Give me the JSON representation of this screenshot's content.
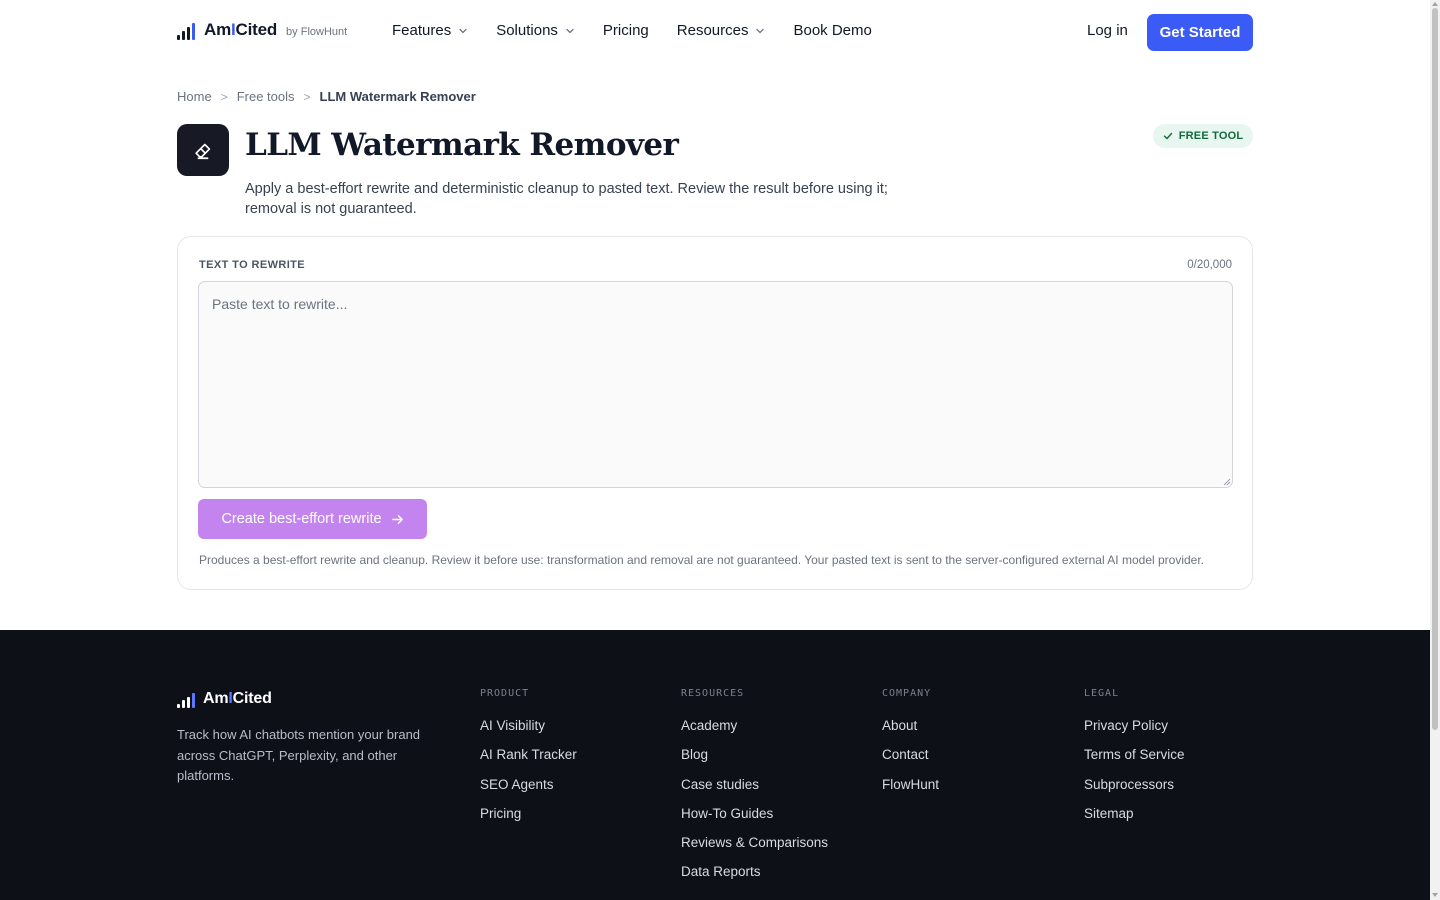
{
  "header": {
    "logo": {
      "name_prefix": "Am",
      "name_i": "I",
      "name_suffix": "Cited",
      "by": "by FlowHunt"
    },
    "nav": [
      {
        "label": "Features",
        "has_dropdown": true
      },
      {
        "label": "Solutions",
        "has_dropdown": true
      },
      {
        "label": "Pricing",
        "has_dropdown": false
      },
      {
        "label": "Resources",
        "has_dropdown": true
      },
      {
        "label": "Book Demo",
        "has_dropdown": false
      }
    ],
    "login_label": "Log in",
    "cta_label": "Get Started"
  },
  "breadcrumb": {
    "items": [
      "Home",
      "Free tools"
    ],
    "current": "LLM Watermark Remover",
    "separator": ">"
  },
  "tool": {
    "icon": "eraser-icon",
    "title": "LLM Watermark Remover",
    "subtitle_line1": "Apply a best-effort rewrite and deterministic cleanup to pasted text. Review the result before using it;",
    "subtitle_line2": "removal is not guaranteed.",
    "badge": "FREE TOOL"
  },
  "form": {
    "label": "TEXT TO REWRITE",
    "counter": "0/20,000",
    "value": "",
    "placeholder": "Paste text to rewrite...",
    "submit_label": "Create best-effort rewrite",
    "disclaimer": "Produces a best-effort rewrite and cleanup. Review it before use: transformation and removal are not guaranteed. Your pasted text is sent to the server-configured external AI model provider."
  },
  "footer": {
    "logo": {
      "name_prefix": "Am",
      "name_i": "I",
      "name_suffix": "Cited"
    },
    "tagline": "Track how AI chatbots mention your brand across ChatGPT, Perplexity, and other platforms.",
    "columns": [
      {
        "heading": "PRODUCT",
        "links": [
          "AI Visibility",
          "AI Rank Tracker",
          "SEO Agents",
          "Pricing"
        ]
      },
      {
        "heading": "RESOURCES",
        "links": [
          "Academy",
          "Blog",
          "Case studies",
          "How-To Guides",
          "Reviews & Comparisons",
          "Data Reports"
        ]
      },
      {
        "heading": "COMPANY",
        "links": [
          "About",
          "Contact",
          "FlowHunt"
        ]
      },
      {
        "heading": "LEGAL",
        "links": [
          "Privacy Policy",
          "Terms of Service",
          "Subprocessors",
          "Sitemap"
        ]
      }
    ]
  },
  "colors": {
    "brand_blue": "#3b5bf6",
    "submit_purple": "#c484f0",
    "footer_bg": "#0d1017",
    "badge_bg": "#e7f6ee",
    "badge_text": "#116a3c"
  }
}
